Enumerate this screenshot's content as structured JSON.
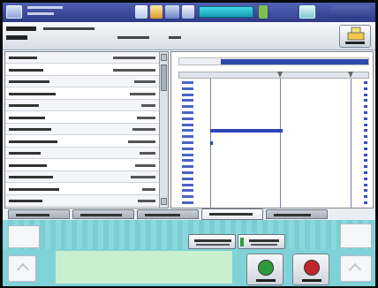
{
  "top_bar": {
    "logo_icon": "app-logo-icon",
    "title": "",
    "subtitle": "",
    "accent_color": "#2e3a86"
  },
  "header": {
    "title_line1": "",
    "title_line2": "",
    "print_button_label": ""
  },
  "data_panel": {
    "rows": [
      {
        "label": "",
        "value": ""
      },
      {
        "label": "",
        "value": ""
      },
      {
        "label": "",
        "value": ""
      },
      {
        "label": "",
        "value": ""
      },
      {
        "label": "",
        "value": ""
      },
      {
        "label": "",
        "value": ""
      },
      {
        "label": "",
        "value": ""
      },
      {
        "label": "",
        "value": ""
      },
      {
        "label": "",
        "value": ""
      },
      {
        "label": "",
        "value": ""
      },
      {
        "label": "",
        "value": ""
      },
      {
        "label": "",
        "value": ""
      },
      {
        "label": "",
        "value": ""
      }
    ]
  },
  "distribution": {
    "strip_fill_fraction": 0.78,
    "rows": [
      {
        "fraction": 0.0
      },
      {
        "fraction": 0.0
      },
      {
        "fraction": 0.0
      },
      {
        "fraction": 0.0
      },
      {
        "fraction": 0.0
      },
      {
        "fraction": 0.0
      },
      {
        "fraction": 0.0
      },
      {
        "fraction": 0.0
      },
      {
        "fraction": 0.48
      },
      {
        "fraction": 0.0
      },
      {
        "fraction": 0.02
      },
      {
        "fraction": 0.0
      },
      {
        "fraction": 0.0
      },
      {
        "fraction": 0.0
      },
      {
        "fraction": 0.0
      },
      {
        "fraction": 0.0
      },
      {
        "fraction": 0.0
      },
      {
        "fraction": 0.0
      },
      {
        "fraction": 0.0
      },
      {
        "fraction": 0.0
      },
      {
        "fraction": 0.0
      }
    ]
  },
  "tabs": [
    {
      "label": "",
      "active": false
    },
    {
      "label": "",
      "active": false
    },
    {
      "label": "",
      "active": false
    },
    {
      "label": "",
      "active": true
    },
    {
      "label": "",
      "active": false
    }
  ],
  "controls": {
    "run_button": {
      "label": "",
      "color": "#2e9a3a",
      "icon": "play-icon"
    },
    "stop_button": {
      "label": "",
      "color": "#c0262b",
      "icon": "stop-icon"
    }
  }
}
